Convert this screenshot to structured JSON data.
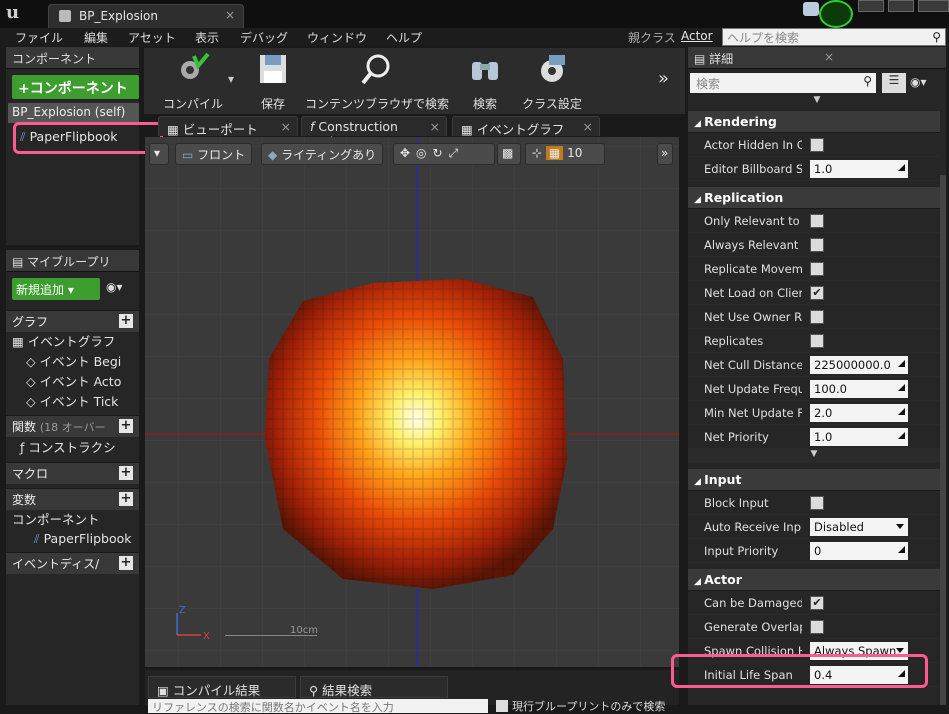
{
  "window": {
    "tab_title": "BP_Explosion"
  },
  "menu": [
    "ファイル",
    "編集",
    "アセット",
    "表示",
    "デバッグ",
    "ウィンドウ",
    "ヘルプ"
  ],
  "parent_class": {
    "label": "親クラス",
    "value": "Actor"
  },
  "help_search": {
    "placeholder": "ヘルプを検索"
  },
  "components_panel": {
    "header": "コンポーネント",
    "add_button": "+コンポーネント",
    "root_item": "BP_Explosion (self)",
    "child_item": "PaperFlipbook"
  },
  "toolbar": {
    "compile": "コンパイル",
    "save": "保存",
    "content_browser": "コンテンツブラウザで検索",
    "search": "検索",
    "class_settings": "クラス設定"
  },
  "editor_tabs": [
    "ビューポート",
    "Construction Script",
    "イベントグラフ"
  ],
  "viewport": {
    "view_mode": "フロント",
    "lighting": "ライティングあり",
    "grid_value": "10",
    "scale_label": "10cm",
    "axis_z": "Z",
    "axis_x": "X"
  },
  "my_blueprint": {
    "header": "マイブループリ",
    "add_new": "新規追加",
    "graph_cat": "グラフ",
    "event_graph": "イベントグラフ",
    "events": [
      "イベント Begi",
      "イベント Acto",
      "イベント Tick"
    ],
    "functions_cat": "関数",
    "functions_note": "(18 オーバー",
    "construction": "コンストラクシ",
    "macros_cat": "マクロ",
    "variables_cat": "変数",
    "components_sub": "コンポーネント",
    "components_item": "PaperFlipbook",
    "dispatchers_cat": "イベントディス/"
  },
  "bottom_tabs": [
    "コンパイル結果",
    "結果検索"
  ],
  "bottom_hint": "リファレンスの検索に関数名かイベント名を入力",
  "bottom_checkbox": "現行ブループリントのみで検索",
  "details": {
    "header": "詳細",
    "search_placeholder": "検索",
    "sections": [
      {
        "title": "Rendering",
        "rows": [
          {
            "name": "Actor Hidden In Gam",
            "type": "check",
            "checked": false
          },
          {
            "name": "Editor Billboard Sca",
            "type": "num",
            "value": "1.0"
          }
        ]
      },
      {
        "title": "Replication",
        "rows": [
          {
            "name": "Only Relevant to Ow",
            "type": "check",
            "checked": false
          },
          {
            "name": "Always Relevant",
            "type": "check",
            "checked": false
          },
          {
            "name": "Replicate Movemen",
            "type": "check",
            "checked": false
          },
          {
            "name": "Net Load on Client",
            "type": "check",
            "checked": true
          },
          {
            "name": "Net Use Owner Rele",
            "type": "check",
            "checked": false
          },
          {
            "name": "Replicates",
            "type": "check",
            "checked": false
          },
          {
            "name": "Net Cull Distance Sc",
            "type": "num",
            "value": "225000000.0"
          },
          {
            "name": "Net Update Frequen",
            "type": "num",
            "value": "100.0"
          },
          {
            "name": "Min Net Update Fre",
            "type": "num",
            "value": "2.0"
          },
          {
            "name": "Net Priority",
            "type": "num",
            "value": "1.0"
          }
        ]
      },
      {
        "title": "Input",
        "rows": [
          {
            "name": "Block Input",
            "type": "check",
            "checked": false
          },
          {
            "name": "Auto Receive Input",
            "type": "dd",
            "value": "Disabled"
          },
          {
            "name": "Input Priority",
            "type": "num",
            "value": "0"
          }
        ]
      },
      {
        "title": "Actor",
        "rows": [
          {
            "name": "Can be Damaged",
            "type": "check",
            "checked": true
          },
          {
            "name": "Generate Overlap Ev",
            "type": "check",
            "checked": false
          },
          {
            "name": "Spawn Collision Har",
            "type": "dd",
            "value": "Always Spawn,"
          },
          {
            "name": "Initial Life Span",
            "type": "num",
            "value": "0.4"
          }
        ]
      }
    ]
  },
  "colors": {
    "accent_green": "#3d9e2f",
    "highlight": "#ff5b93"
  }
}
